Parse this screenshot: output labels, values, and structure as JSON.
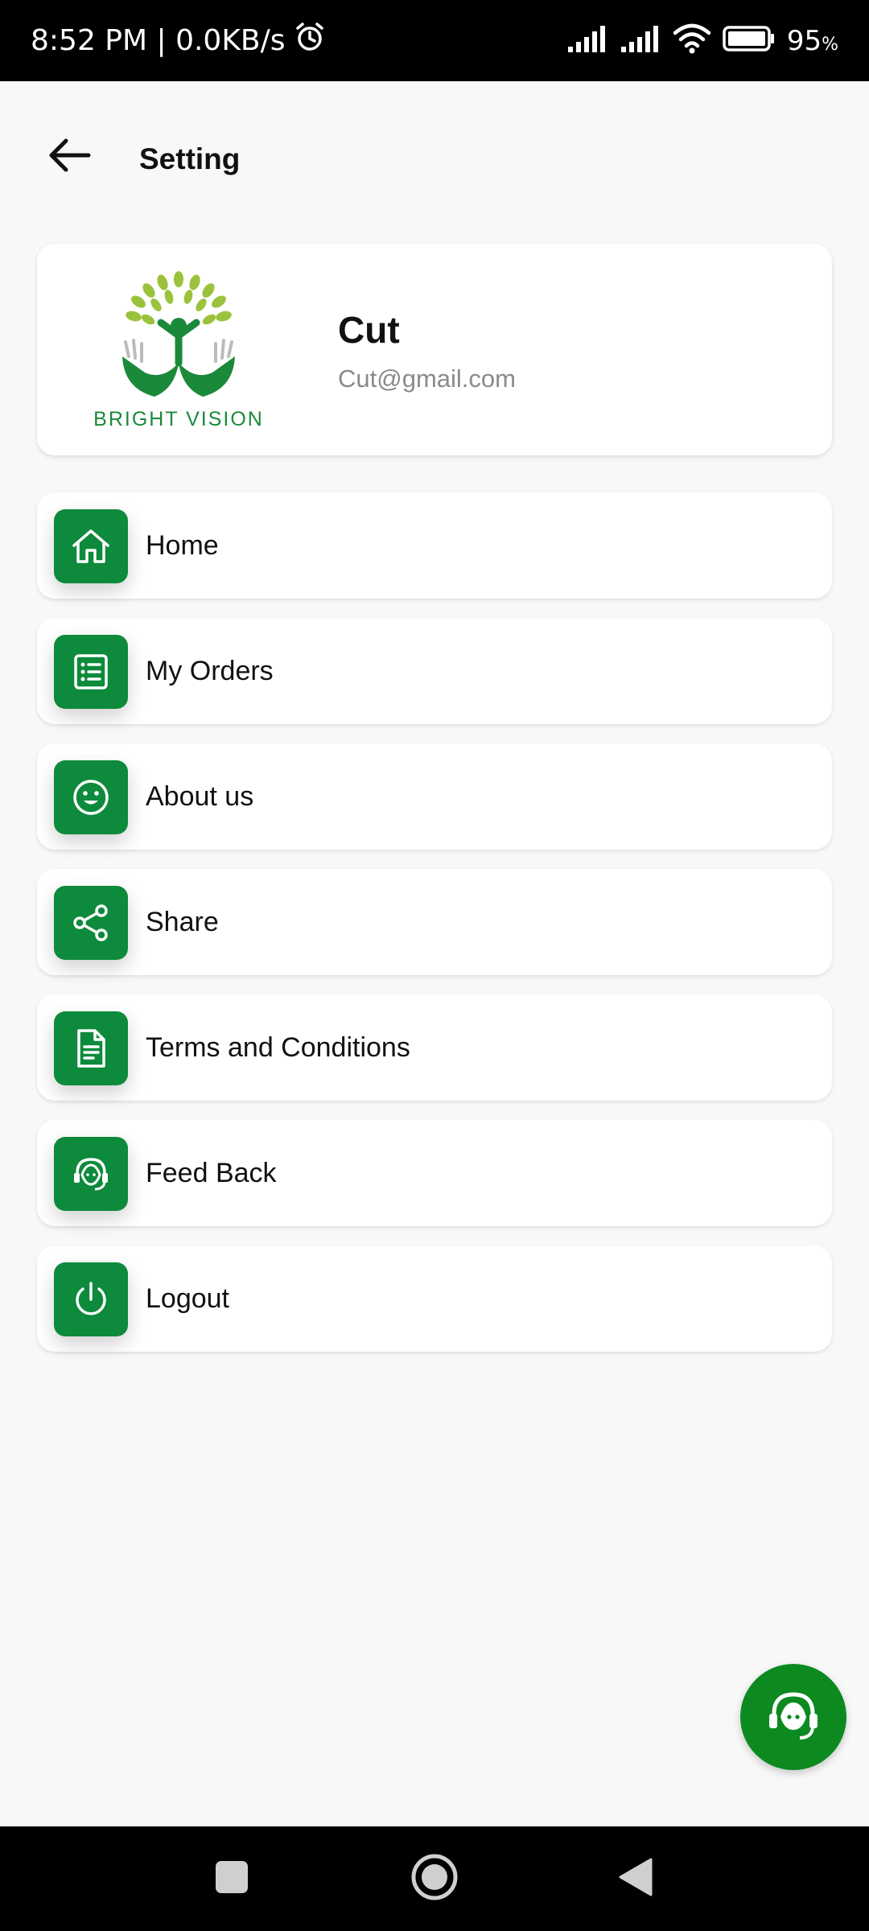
{
  "status_bar": {
    "time_text": "8:52 PM | 0.0KB/s",
    "battery_percent": "95",
    "battery_unit": "%",
    "icons": [
      "alarm-icon",
      "signal-icon",
      "signal-icon",
      "wifi-icon",
      "battery-icon"
    ]
  },
  "header": {
    "title": "Setting",
    "back_icon": "arrow-left-icon"
  },
  "profile": {
    "name": "Cut",
    "email": "Cut@gmail.com",
    "logo_text": "BRIGHT VISION"
  },
  "menu": {
    "items": [
      {
        "label": "Home",
        "icon": "home-icon"
      },
      {
        "label": "My Orders",
        "icon": "list-icon"
      },
      {
        "label": "About us",
        "icon": "smiley-icon"
      },
      {
        "label": "Share",
        "icon": "share-icon"
      },
      {
        "label": "Terms and Conditions",
        "icon": "document-icon"
      },
      {
        "label": "Feed Back",
        "icon": "headset-icon"
      },
      {
        "label": "Logout",
        "icon": "power-icon"
      }
    ]
  },
  "fab": {
    "icon": "support-headset-icon"
  },
  "nav_bar": {
    "icons": [
      "recents-icon",
      "home-circle-icon",
      "back-triangle-icon"
    ]
  },
  "colors": {
    "accent_green": "#0d8a3b",
    "fab_green": "#0c8a20",
    "background": "#f8f8f8"
  }
}
